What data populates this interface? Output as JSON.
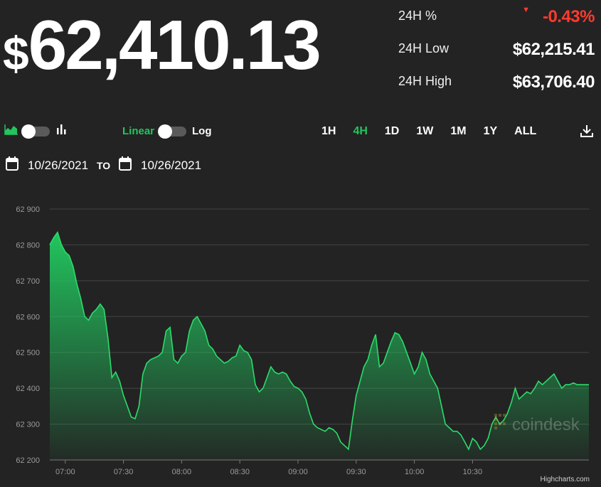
{
  "price": {
    "currency_symbol": "$",
    "value": "62,410.13"
  },
  "stats": [
    {
      "label": "24H %",
      "value": "-0.43%",
      "direction": "down"
    },
    {
      "label": "24H Low",
      "value": "$62,215.41"
    },
    {
      "label": "24H High",
      "value": "$63,706.40"
    }
  ],
  "controls": {
    "chart_type_icons": [
      "area-chart-icon",
      "bar-chart-icon"
    ],
    "scale_labels": {
      "linear": "Linear",
      "log": "Log"
    },
    "ranges": [
      "1H",
      "4H",
      "1D",
      "1W",
      "1M",
      "1Y",
      "ALL"
    ],
    "active_range": "4H",
    "download_icon": "download-icon"
  },
  "date_range": {
    "from": "10/26/2021",
    "to_label": "TO",
    "to": "10/26/2021"
  },
  "colors": {
    "accent": "#22c55e",
    "negative": "#ff3b30",
    "line": "#2bdc6a",
    "background": "#232323"
  },
  "watermark": "coindesk",
  "credit": "Highcharts.com",
  "chart_data": {
    "type": "area",
    "x_tick_labels": [
      "07:00",
      "07:30",
      "08:00",
      "08:30",
      "09:00",
      "09:30",
      "10:00",
      "10:30"
    ],
    "y_tick_labels": [
      "62 200",
      "62 300",
      "62 400",
      "62 500",
      "62 600",
      "62 700",
      "62 800",
      "62 900"
    ],
    "ylim": [
      62200,
      62900
    ],
    "xlim": [
      "06:52",
      "11:30"
    ],
    "grid": true,
    "series": [
      {
        "x": [
          "06:52",
          "06:54",
          "06:56",
          "06:58",
          "07:00",
          "07:02",
          "07:04",
          "07:06",
          "07:08",
          "07:10",
          "07:12",
          "07:14",
          "07:16",
          "07:18",
          "07:20",
          "07:22",
          "07:24",
          "07:26",
          "07:28",
          "07:30",
          "07:32",
          "07:34",
          "07:36",
          "07:38",
          "07:40",
          "07:42",
          "07:44",
          "07:46",
          "07:48",
          "07:50",
          "07:52",
          "07:54",
          "07:56",
          "07:58",
          "08:00",
          "08:02",
          "08:04",
          "08:06",
          "08:08",
          "08:10",
          "08:12",
          "08:14",
          "08:16",
          "08:18",
          "08:20",
          "08:22",
          "08:24",
          "08:26",
          "08:28",
          "08:30",
          "08:32",
          "08:34",
          "08:36",
          "08:38",
          "08:40",
          "08:42",
          "08:44",
          "08:46",
          "08:48",
          "08:50",
          "08:52",
          "08:54",
          "08:56",
          "08:58",
          "09:00",
          "09:02",
          "09:04",
          "09:06",
          "09:08",
          "09:10",
          "09:12",
          "09:14",
          "09:16",
          "09:18",
          "09:20",
          "09:22",
          "09:24",
          "09:26",
          "09:28",
          "09:30",
          "09:32",
          "09:34",
          "09:36",
          "09:38",
          "09:40",
          "09:42",
          "09:44",
          "09:46",
          "09:48",
          "09:50",
          "09:52",
          "09:54",
          "09:56",
          "09:58",
          "10:00",
          "10:02",
          "10:04",
          "10:06",
          "10:08",
          "10:10",
          "10:12",
          "10:14",
          "10:16",
          "10:18",
          "10:20",
          "10:22",
          "10:24",
          "10:26",
          "10:28",
          "10:30",
          "10:32",
          "10:34",
          "10:36",
          "10:38",
          "10:40",
          "10:42",
          "10:44",
          "10:46",
          "10:48",
          "10:50",
          "10:52",
          "10:54",
          "10:56",
          "10:58",
          "11:00",
          "11:02",
          "11:04",
          "11:06",
          "11:08",
          "11:10",
          "11:12",
          "11:14",
          "11:16",
          "11:18",
          "11:20",
          "11:22",
          "11:24",
          "11:26",
          "11:28",
          "11:30"
        ],
        "y": [
          62800,
          62820,
          62835,
          62800,
          62780,
          62770,
          62740,
          62690,
          62650,
          62600,
          62590,
          62610,
          62620,
          62635,
          62620,
          62540,
          62430,
          62445,
          62420,
          62380,
          62350,
          62320,
          62315,
          62350,
          62440,
          62470,
          62480,
          62485,
          62490,
          62500,
          62560,
          62570,
          62480,
          62470,
          62490,
          62500,
          62560,
          62590,
          62600,
          62580,
          62560,
          62520,
          62510,
          62490,
          62480,
          62470,
          62475,
          62485,
          62490,
          62520,
          62505,
          62500,
          62480,
          62410,
          62390,
          62400,
          62430,
          62460,
          62445,
          62440,
          62445,
          62440,
          62420,
          62405,
          62400,
          62390,
          62370,
          62330,
          62300,
          62290,
          62285,
          62280,
          62290,
          62285,
          62275,
          62250,
          62240,
          62230,
          62310,
          62380,
          62420,
          62460,
          62480,
          62520,
          62550,
          62460,
          62470,
          62500,
          62530,
          62555,
          62550,
          62530,
          62500,
          62470,
          62440,
          62460,
          62500,
          62480,
          62440,
          62420,
          62400,
          62350,
          62300,
          62290,
          62280,
          62280,
          62270,
          62250,
          62230,
          62260,
          62250,
          62230,
          62240,
          62260,
          62300,
          62320,
          62300,
          62310,
          62330,
          62360,
          62400,
          62370,
          62380,
          62390,
          62385,
          62400,
          62420,
          62410,
          62420,
          62430,
          62440,
          62420,
          62400,
          62410,
          62410,
          62415,
          62410,
          62410,
          62410,
          62410
        ]
      }
    ]
  }
}
